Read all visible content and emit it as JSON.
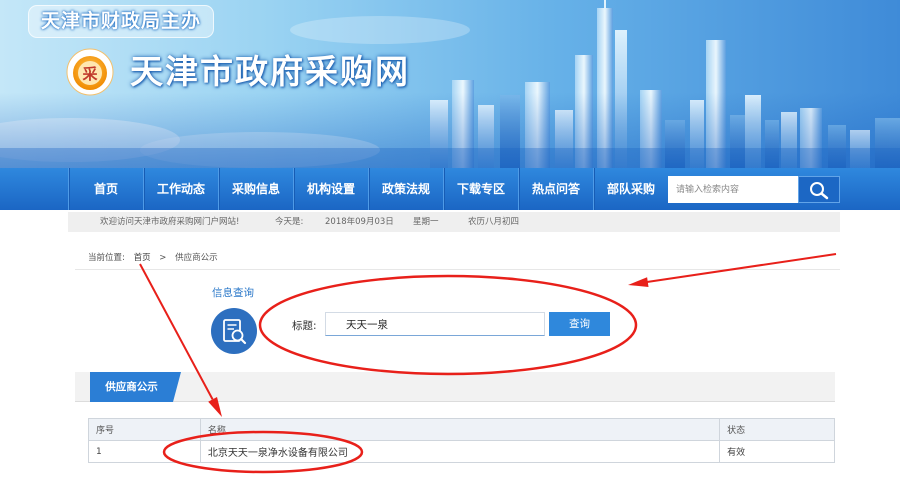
{
  "header": {
    "badge": "天津市财政局主办",
    "site_title": "天津市政府采购网",
    "logo_char": "采"
  },
  "nav": {
    "items": [
      "首页",
      "工作动态",
      "采购信息",
      "机构设置",
      "政策法规",
      "下载专区",
      "热点问答",
      "部队采购"
    ],
    "search_placeholder": "请输入检索内容",
    "search_button_icon": "search-icon"
  },
  "info_bar": {
    "welcome": "欢迎访问天津市政府采购网门户网站!",
    "today_label": "今天是:",
    "date": "2018年09月03日",
    "weekday": "星期一",
    "lunar": "农历八月初四"
  },
  "breadcrumb": {
    "label": "当前位置:",
    "home": "首页",
    "separator": ">",
    "current": "供应商公示"
  },
  "query": {
    "heading": "信息查询",
    "heading_icon": "document-search-icon",
    "title_label": "标题:",
    "title_value": "天天一泉",
    "button": "查询"
  },
  "tab": {
    "label": "供应商公示"
  },
  "table": {
    "headers": [
      "序号",
      "名称",
      "状态"
    ],
    "rows": [
      [
        "1",
        "北京天天一泉净水设备有限公司",
        "有效"
      ]
    ]
  },
  "colors": {
    "nav_blue": "#1b66c4",
    "accent_blue": "#2f88dc",
    "tab_blue": "#2b7ed5",
    "annotation_red": "#e8201a"
  }
}
